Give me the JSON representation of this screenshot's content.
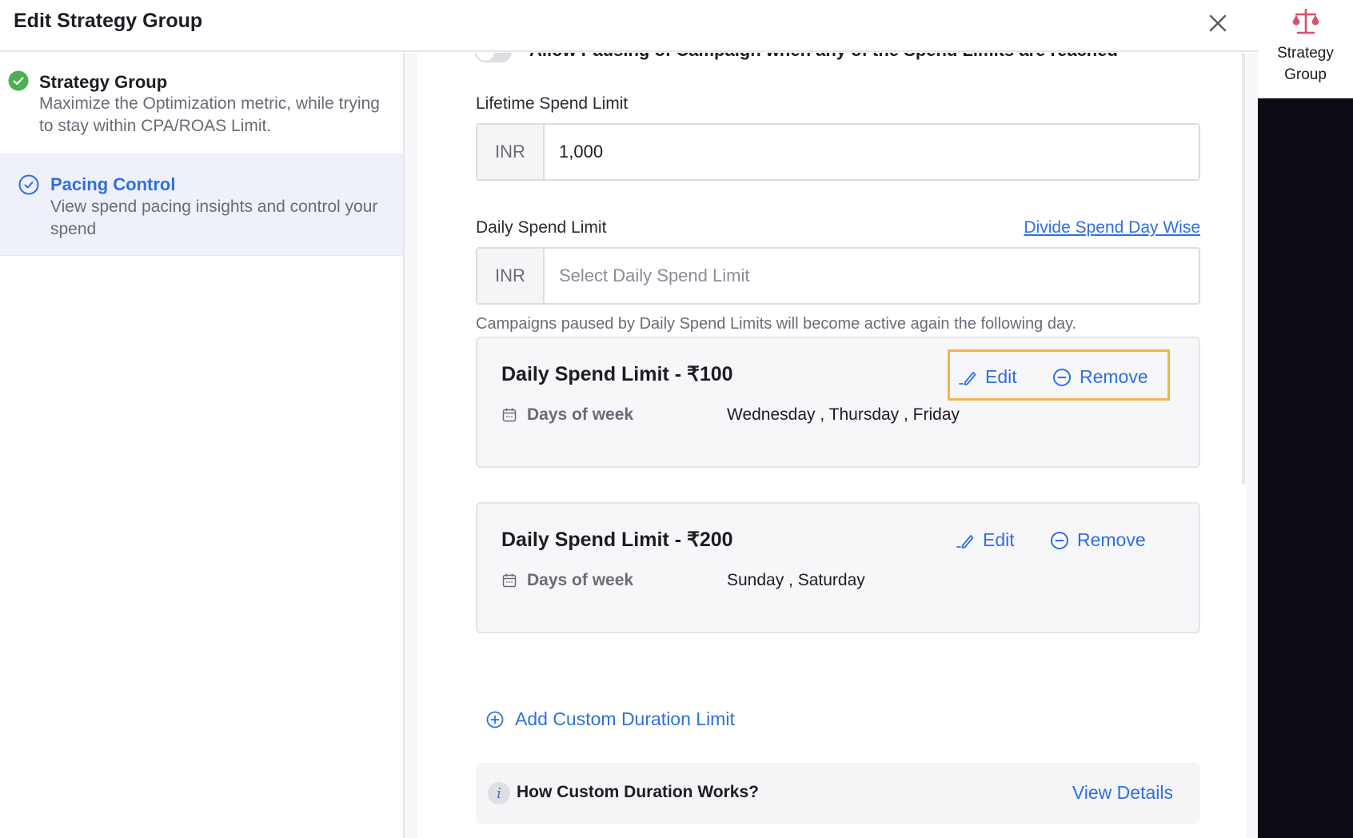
{
  "header": {
    "title": "Edit Strategy Group",
    "close_icon": "close-icon"
  },
  "sidebar": {
    "steps": [
      {
        "title": "Strategy Group",
        "description": "Maximize the Optimization metric, while trying to stay within CPA/ROAS Limit.",
        "status": "completed",
        "icon": "check-circle-filled-icon",
        "color": "#4caf50"
      },
      {
        "title": "Pacing Control",
        "description": "View spend pacing insights and control your spend",
        "status": "active",
        "icon": "check-circle-outline-icon",
        "color": "#2f6fe0"
      }
    ]
  },
  "content": {
    "pause_toggle": {
      "label": "Allow Pausing of Campaign when any of the Spend Limits are reached",
      "checked": false
    },
    "lifetime_spend": {
      "label": "Lifetime Spend Limit",
      "currency": "INR",
      "value": "1,000"
    },
    "daily_spend": {
      "label": "Daily Spend Limit",
      "link": "Divide Spend Day Wise",
      "currency": "INR",
      "placeholder": "Select Daily Spend Limit",
      "value": "",
      "helper": "Campaigns paused by Daily Spend Limits will become active again the following day."
    },
    "limit_cards": [
      {
        "title": "Daily Spend Limit - ₹100",
        "edit_label": "Edit",
        "remove_label": "Remove",
        "days_label": "Days of week",
        "days_value": "Wednesday , Thursday , Friday",
        "highlighted": true
      },
      {
        "title": "Daily Spend Limit - ₹200",
        "edit_label": "Edit",
        "remove_label": "Remove",
        "days_label": "Days of week",
        "days_value": "Sunday , Saturday",
        "highlighted": false
      }
    ],
    "add_custom_label": "Add Custom Duration Limit",
    "info_box": {
      "icon_glyph": "i",
      "text": "How Custom Duration Works?",
      "link": "View Details"
    }
  },
  "right_rail": {
    "tab_label": "Strategy Group",
    "tab_icon": "scale-icon",
    "icon_color": "#d9506d"
  },
  "colors": {
    "accent": "#2f6fe0",
    "highlight_border": "#f0b44c",
    "success": "#4caf50",
    "rail_background": "#0b0c14"
  }
}
